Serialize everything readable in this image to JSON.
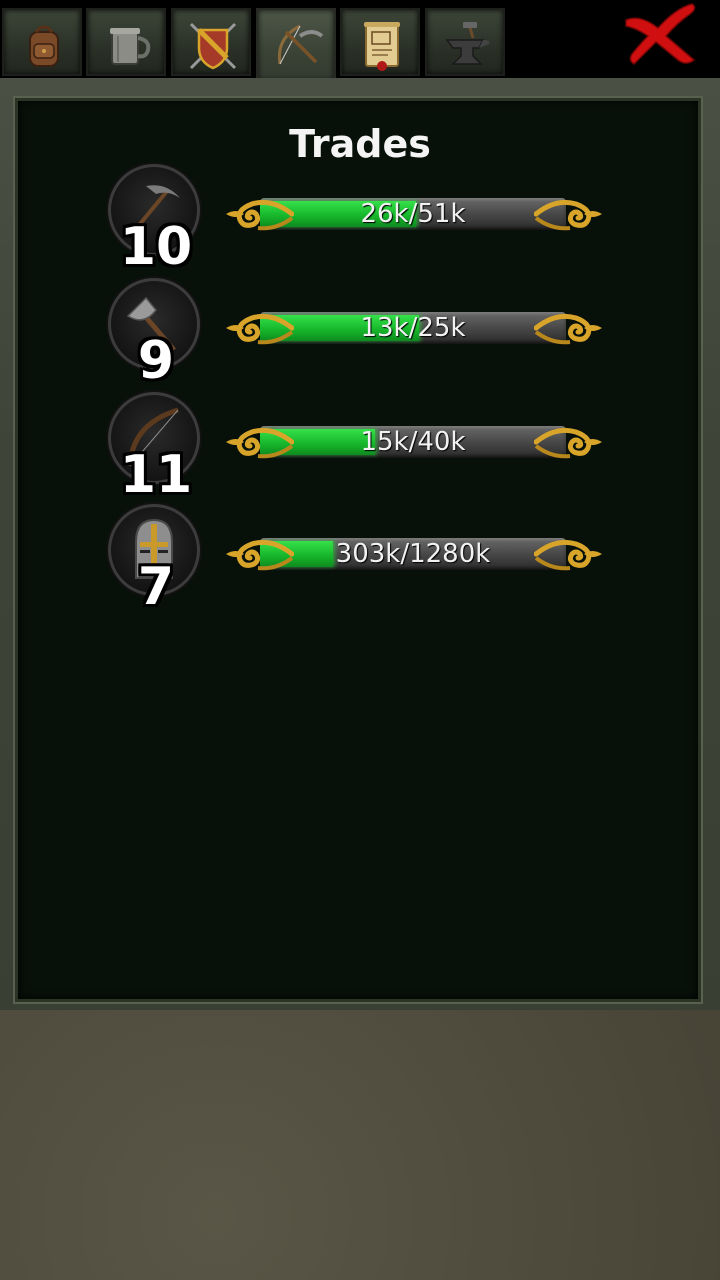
{
  "tabs": [
    {
      "name": "inventory",
      "icon": "backpack-icon"
    },
    {
      "name": "tavern",
      "icon": "tankard-icon"
    },
    {
      "name": "combat",
      "icon": "shield-swords-icon"
    },
    {
      "name": "trades",
      "icon": "pickaxe-bow-icon",
      "active": true
    },
    {
      "name": "quests",
      "icon": "scroll-icon"
    },
    {
      "name": "smithing",
      "icon": "anvil-icon"
    }
  ],
  "close_icon": "red-x-icon",
  "panel": {
    "title": "Trades",
    "trades": [
      {
        "icon": "pickaxe-icon",
        "level": "10",
        "progress_text": "26k/51k",
        "progress": 0.51
      },
      {
        "icon": "hatchet-icon",
        "level": "9",
        "progress_text": "13k/25k",
        "progress": 0.52
      },
      {
        "icon": "bow-icon",
        "level": "11",
        "progress_text": "15k/40k",
        "progress": 0.375
      },
      {
        "icon": "helmet-icon",
        "level": "7",
        "progress_text": "303k/1280k",
        "progress": 0.237
      }
    ]
  },
  "colors": {
    "progress_green": "#17b82c",
    "panel_bg": "#081109",
    "close_red": "#d01010",
    "gold": "#d8a52a"
  }
}
